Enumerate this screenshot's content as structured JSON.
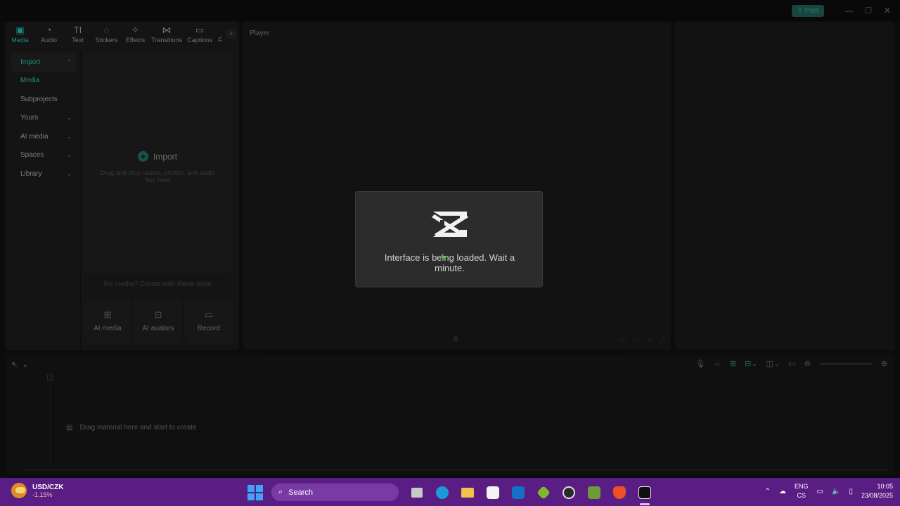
{
  "titlebar": {
    "post_label": "Post",
    "minimize_icon": "minimize-icon",
    "maximize_icon": "maximize-icon",
    "close_icon": "close-icon"
  },
  "toolbar_tabs": [
    {
      "label": "Media",
      "icon": "media-icon",
      "active": true
    },
    {
      "label": "Audio",
      "icon": "audio-icon"
    },
    {
      "label": "Text",
      "icon": "text-icon"
    },
    {
      "label": "Stickers",
      "icon": "stickers-icon"
    },
    {
      "label": "Effects",
      "icon": "effects-icon"
    },
    {
      "label": "Transitions",
      "icon": "transitions-icon"
    },
    {
      "label": "Captions",
      "icon": "captions-icon"
    },
    {
      "label": "F",
      "icon": "filters-icon"
    }
  ],
  "sidebar": {
    "items": [
      {
        "label": "Import",
        "selected": true,
        "chevron": "^"
      },
      {
        "label": "Media",
        "teal": true
      },
      {
        "label": "Subprojects"
      },
      {
        "label": "Yours",
        "chevron": "v"
      },
      {
        "label": "AI media",
        "chevron": "v"
      },
      {
        "label": "Spaces",
        "chevron": "v"
      },
      {
        "label": "Library",
        "chevron": "v"
      }
    ]
  },
  "media_panel": {
    "import_label": "Import",
    "drop_hint": "Drag and drop videos, photos, and audio files here",
    "no_media_text": "No media? Create with these tools",
    "tools": [
      {
        "label": "AI media",
        "icon": "ai-media-icon"
      },
      {
        "label": "AI avatars",
        "icon": "ai-avatars-icon"
      },
      {
        "label": "Record",
        "icon": "record-icon"
      }
    ]
  },
  "player": {
    "title": "Player"
  },
  "timeline": {
    "hint": "Drag material here and start to create"
  },
  "dialog": {
    "message": "Interface is being loaded. Wait a minute."
  },
  "taskbar": {
    "widget_title": "USD/CZK",
    "widget_sub": "-1,15%",
    "search_placeholder": "Search",
    "lang_top": "ENG",
    "lang_bottom": "CS",
    "time": "10:05",
    "date": "23/08/2025",
    "colors": {
      "bar": "#5a1d84",
      "accent": "#1e9a8c"
    }
  }
}
